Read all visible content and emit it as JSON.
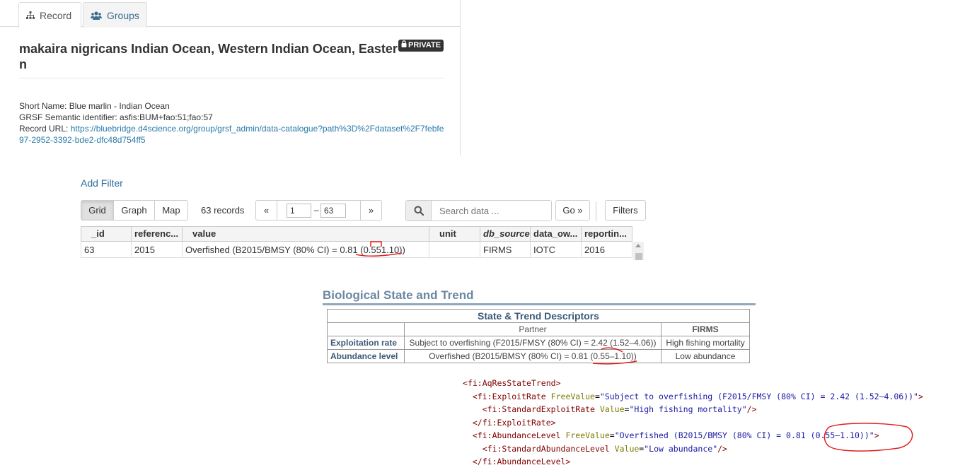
{
  "tabs": [
    {
      "label": "Record",
      "active": true
    },
    {
      "label": "Groups",
      "active": false
    }
  ],
  "record": {
    "title": "makaira nigricans Indian Ocean, Western Indian Ocean, Eastern",
    "badge": "PRIVATE",
    "short_name": "Short Name: Blue marlin - Indian Ocean",
    "semantic_id": "GRSF Semantic identifier: asfis:BUM+fao:51;fao:57",
    "url_label": "Record URL: ",
    "url": "https://bluebridge.d4science.org/group/grsf_admin/data-catalogue?path%3D%2Fdataset%2F7febfe97-2952-3392-bde2-dfc48d754ff5"
  },
  "explorer": {
    "add_filter": "Add Filter",
    "views": [
      "Grid",
      "Graph",
      "Map"
    ],
    "active_view": "Grid",
    "records_count": "63 records",
    "pager": {
      "prev": "«",
      "next": "»",
      "from": "1",
      "to": "63",
      "dash": "–"
    },
    "search_placeholder": "Search data ...",
    "go_label": "Go »",
    "filters_label": "Filters",
    "columns": [
      "_id",
      "referenc...",
      "value",
      "unit",
      "db_source",
      "data_ow...",
      "reportin..."
    ],
    "rows": [
      [
        "63",
        "2015",
        "Overfished (B2015/BMSY (80% CI) = 0.81 (0.551.10))",
        "",
        "FIRMS",
        "IOTC",
        "2016"
      ]
    ]
  },
  "bio": {
    "title": "Biological State and Trend",
    "table_caption": "State & Trend Descriptors",
    "col_partner": "Partner",
    "col_firms": "FIRMS",
    "rows": [
      {
        "label": "Exploitation rate",
        "partner": "Subject to overfishing (F2015/FMSY (80% CI) = 2.42 (1.52–4.06))",
        "firms": "High fishing mortality"
      },
      {
        "label": "Abundance level",
        "partner": "Overfished (B2015/BMSY (80% CI) = 0.81 (0.55–1.10))",
        "firms": "Low abundance"
      }
    ]
  },
  "xml": {
    "root": "fi:AqResStateTrend",
    "exploit_tag": "fi:ExploitRate",
    "exploit_attr": "FreeValue",
    "exploit_value": "Subject to overfishing (F2015/FMSY (80% CI) = 2.42 (1.52–4.06))",
    "std_exploit_tag": "fi:StandardExploitRate",
    "std_exploit_attr": "Value",
    "std_exploit_value": "High fishing mortality",
    "abund_tag": "fi:AbundanceLevel",
    "abund_attr": "FreeValue",
    "abund_value_prefix": "Overfished (B2015/BMSY (80% CI) = 0.81 ",
    "abund_value_highlight": "(0.55–1.10)",
    "abund_value_suffix": ")",
    "std_abund_tag": "fi:StandardAbundanceLevel",
    "std_abund_attr": "Value",
    "std_abund_value": "Low abundance"
  },
  "colors": {
    "link": "#2a7aa8",
    "annotation": "#e02020",
    "bio_title": "#6b88a3"
  }
}
